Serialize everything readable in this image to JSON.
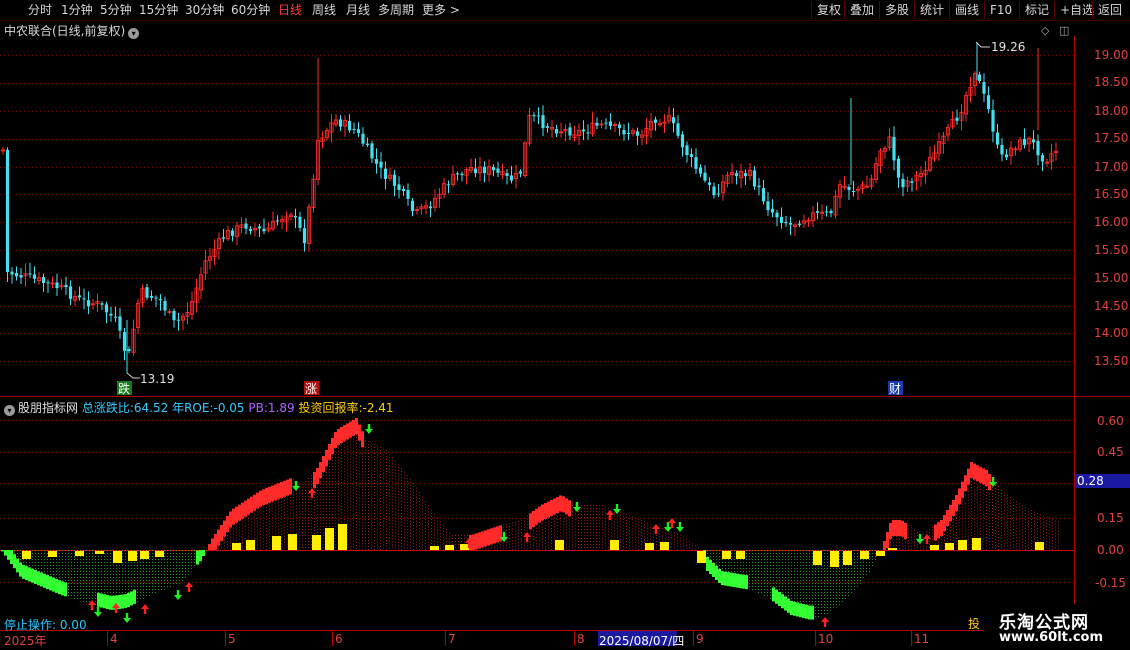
{
  "toolbar": {
    "periods": [
      "分时",
      "1分钟",
      "5分钟",
      "15分钟",
      "30分钟",
      "60分钟",
      "日线",
      "周线",
      "月线",
      "多周期",
      "更多 >"
    ],
    "active_period": "日线",
    "right_buttons": [
      "复权",
      "叠加",
      "多股",
      "统计",
      "画线",
      "F10",
      "标记",
      "+自选",
      "返回"
    ]
  },
  "main_chart": {
    "title": "中农联合(日线,前复权)",
    "price_ticks": [
      "19.00",
      "18.50",
      "18.00",
      "17.50",
      "17.00",
      "16.50",
      "16.00",
      "15.50",
      "15.00",
      "14.50",
      "14.00",
      "13.50"
    ],
    "high_label": "19.26",
    "low_label": "13.19",
    "markers": [
      "跌",
      "涨",
      "财"
    ]
  },
  "indicator": {
    "name": "股朋指标网",
    "total_ratio_label": "总涨跌比:",
    "total_ratio": "64.52",
    "roe_label": "年ROE:",
    "roe": "-0.05",
    "pb_label": "PB:",
    "pb": "1.89",
    "return_label": "投资回报率:",
    "return": "-2.41",
    "ticks": [
      "0.60",
      "0.45",
      "0.30",
      "0.15",
      "0.00",
      "-0.15"
    ],
    "current_value": "0.28",
    "stop_op": "停止操作: 0.00",
    "side_char": "投"
  },
  "date_axis": {
    "labels": [
      "2025年",
      "4",
      "5",
      "6",
      "7",
      "8",
      "9",
      "10",
      "11"
    ],
    "cursor_date": "2025/08/07/四"
  },
  "watermark": {
    "line1": "乐淘公式网",
    "line2": "www.60lt.com"
  },
  "colors": {
    "up": "#ff2a2a",
    "down": "#44e0f0",
    "green_bar": "#33ff33",
    "yellow_bar": "#ffee00",
    "grid": "#7a0000",
    "axis": "#c00000",
    "cursor_bg": "#1a1aa0"
  }
}
